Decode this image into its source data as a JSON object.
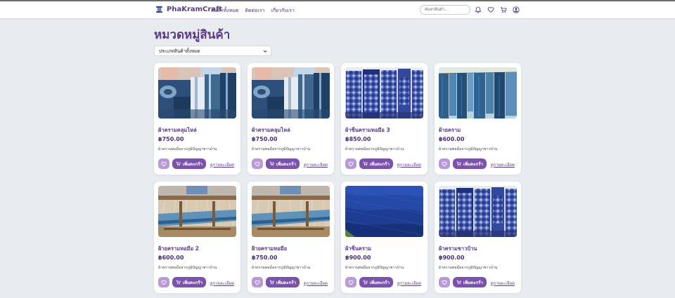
{
  "header": {
    "brand": "PhaKramCraft",
    "nav": [
      "สินค้าทั้งหมด",
      "ติดต่อเรา",
      "เกี่ยวกับเรา"
    ],
    "search_placeholder": "ค้นหาสินค้า...",
    "icons": [
      "bell-icon",
      "heart-icon",
      "cart-icon",
      "user-icon"
    ]
  },
  "page": {
    "title": "หมวดหมู่สินค้า",
    "filter": {
      "selected": "ประเภทสินค้าทั้งหมด"
    }
  },
  "product_labels": {
    "add_to_cart": "เพิ่มตะกร้า",
    "details": "ดูรายละเอียด"
  },
  "products": [
    {
      "name": "ผ้าครามคลุมไหล่",
      "price": "฿750.00",
      "description": "ผ้าครามทอมือจากภูมิปัญญาชาวบ้าน",
      "image": "folded-indigo-scarves"
    },
    {
      "name": "ผ้าครามคลุมไหล่",
      "price": "฿750.00",
      "description": "ผ้าครามทอมือจากภูมิปัญญาชาวบ้าน",
      "image": "folded-indigo-scarves"
    },
    {
      "name": "ผ้าซิ่นครามทอมือ 3",
      "price": "฿850.00",
      "description": "ผ้าครามทอมือจากภูมิปัญญาชาวบ้าน",
      "image": "patterned-indigo-hangings"
    },
    {
      "name": "ผ้ายคราม",
      "price": "฿600.00",
      "description": "ผ้าครามทอมือจากภูมิปัญญาชาวบ้าน",
      "image": "hanging-indigo-yarn"
    },
    {
      "name": "ฝ้ายครามทอมือ 2",
      "price": "฿600.00",
      "description": "ผ้าครามทอมือจากภูมิปัญญาชาวบ้าน",
      "image": "weaving-loom"
    },
    {
      "name": "ฝ้ายครามทอมือ",
      "price": "฿750.00",
      "description": "ผ้าครามทอมือจากภูมิปัญญาชาวบ้าน",
      "image": "weaving-loom"
    },
    {
      "name": "ผ้าซิ่นคราม",
      "price": "฿900.00",
      "description": "ผ้าครามทอมือจากภูมิปัญญาชาวบ้าน",
      "image": "indigo-fabric-closeup"
    },
    {
      "name": "ผ้าครามชาวบ้าน",
      "price": "฿900.00",
      "description": "ผ้าครามทอมือจากภูมิปัญญาชาวบ้าน",
      "image": "patterned-indigo-hangings"
    }
  ],
  "colors": {
    "brand": "#5b3a87",
    "button": "#7b52ab",
    "fav_button": "#b79ad6",
    "background": "#e8ebf0"
  }
}
